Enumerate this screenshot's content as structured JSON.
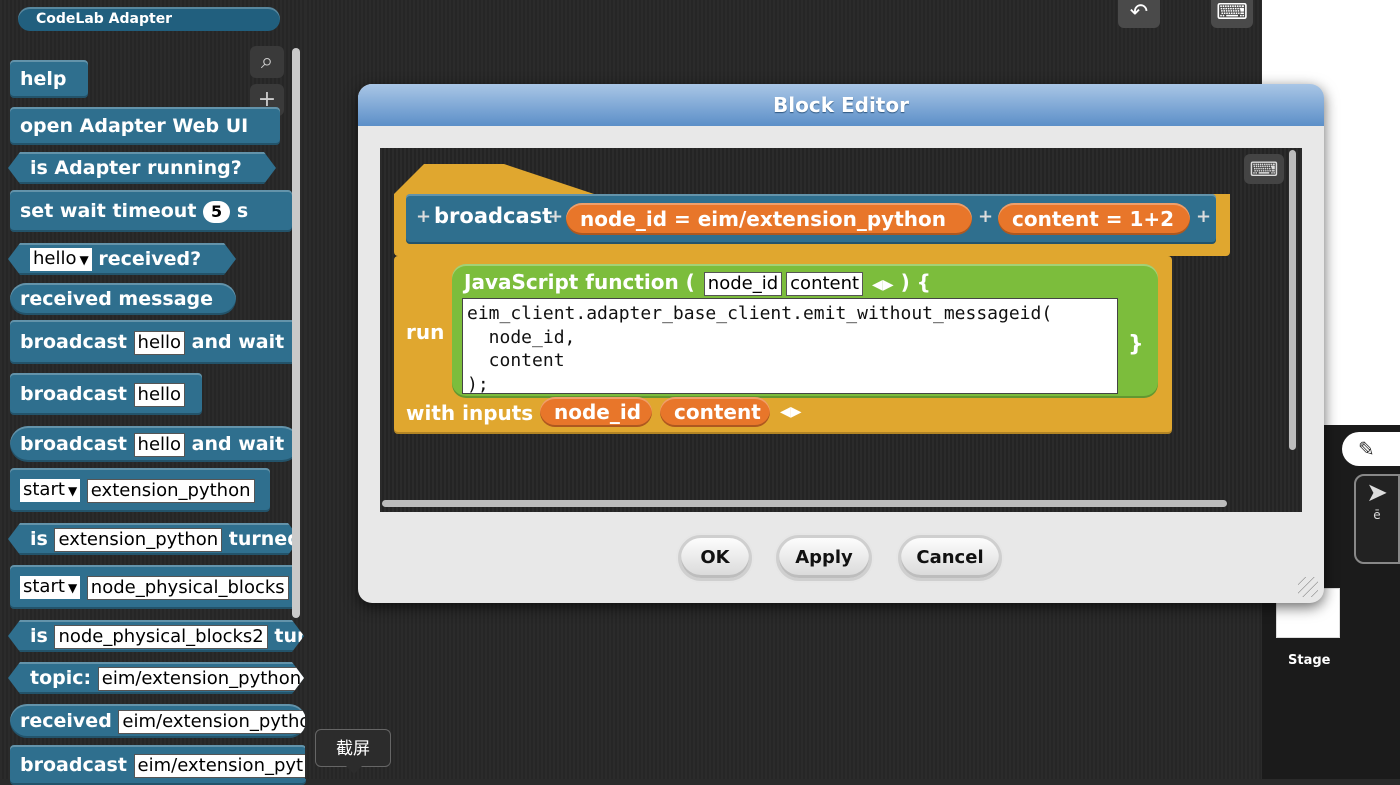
{
  "palette": {
    "category": "CodeLab Adapter",
    "tools": {
      "search": "⌕",
      "add": "+"
    },
    "blocks": {
      "help": "help",
      "open_web_ui": "open Adapter Web UI",
      "is_running": "is Adapter running?",
      "set_wait_timeout": "set wait timeout",
      "timeout_value": "5",
      "timeout_unit": "s",
      "hello_received_dropdown": "hello",
      "received_q": "received?",
      "received_message": "received message",
      "broadcast_wait_1_label": "broadcast",
      "broadcast_wait_1_slot": "hello",
      "broadcast_wait_1_suffix": "and wait",
      "broadcast_label": "broadcast",
      "broadcast_slot": "hello",
      "broadcast_wait_2_label": "broadcast",
      "broadcast_wait_2_slot": "hello",
      "broadcast_wait_2_suffix": "and wait",
      "start1_dropdown": "start",
      "start1_slot": "extension_python",
      "is1_label": "is",
      "is1_slot": "extension_python",
      "is1_suffix": "turned",
      "start2_dropdown": "start",
      "start2_slot": "node_physical_blocks",
      "is2_label": "is",
      "is2_slot": "node_physical_blocks2",
      "is2_suffix": "tur",
      "topic_label": "topic:",
      "topic_slot": "eim/extension_python",
      "received_label": "received",
      "received_slot": "eim/extension_pytho",
      "broadcast3_label": "broadcast",
      "broadcast3_slot": "eim/extension_pyt"
    }
  },
  "toolbar": {
    "undo_icon": "↶",
    "keyboard_icon": "⌨"
  },
  "tooltip": "截屏",
  "dialog": {
    "title": "Block Editor",
    "hat": {
      "label": "broadcast",
      "param1": "node_id = eim/extension_python",
      "param2": "content = 1+2"
    },
    "run_label": "run",
    "js": {
      "title": "JavaScript function (",
      "param1": "node_id",
      "param2": "content",
      "close": ") {",
      "code": "eim_client.adapter_base_client.emit_without_messageid(\n  node_id,\n  content\n);",
      "brace": "}"
    },
    "with_inputs_label": "with inputs",
    "input1": "node_id",
    "input2": "content",
    "buttons": {
      "ok": "OK",
      "apply": "Apply",
      "cancel": "Cancel"
    }
  },
  "stage": {
    "label": "Stage"
  },
  "sprite": {
    "label": "ē"
  }
}
